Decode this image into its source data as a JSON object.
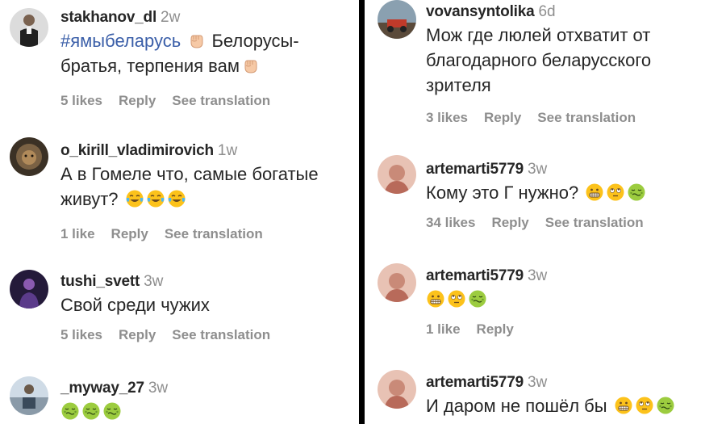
{
  "left": [
    {
      "user": "stakhanov_dl",
      "age": "2w",
      "hashtag": "#ямыбеларусь",
      "line1": "Белорусы-",
      "line2": "братья, терпения вам",
      "likes": "5 likes",
      "reply": "Reply",
      "translate": "See translation"
    },
    {
      "user": "o_kirill_vladimirovich",
      "age": "1w",
      "line1": "А в Гомеле что, самые богатые",
      "line2": "живут?",
      "likes": "1 like",
      "reply": "Reply",
      "translate": "See translation"
    },
    {
      "user": "tushi_svett",
      "age": "3w",
      "line1": "Свой среди чужих",
      "likes": "5 likes",
      "reply": "Reply",
      "translate": "See translation"
    },
    {
      "user": "_myway_27",
      "age": "3w"
    }
  ],
  "right": [
    {
      "user": "vovansyntolika",
      "age": "6d",
      "line1": "Мож где люлей отхватит от",
      "line2": "благодарного беларусского",
      "line3": "зрителя",
      "likes": "3 likes",
      "reply": "Reply",
      "translate": "See translation"
    },
    {
      "user": "artemarti5779",
      "age": "3w",
      "line1": "Кому это Г нужно?",
      "likes": "34 likes",
      "reply": "Reply",
      "translate": "See translation"
    },
    {
      "user": "artemarti5779",
      "age": "3w",
      "likes": "1 like",
      "reply": "Reply"
    },
    {
      "user": "artemarti5779",
      "age": "3w",
      "line1": "И даром не пошёл бы"
    }
  ],
  "emoji_icons": [
    "raised-fist",
    "tears-of-joy",
    "grimacing-face",
    "eye-roll-face",
    "nauseated-face"
  ]
}
